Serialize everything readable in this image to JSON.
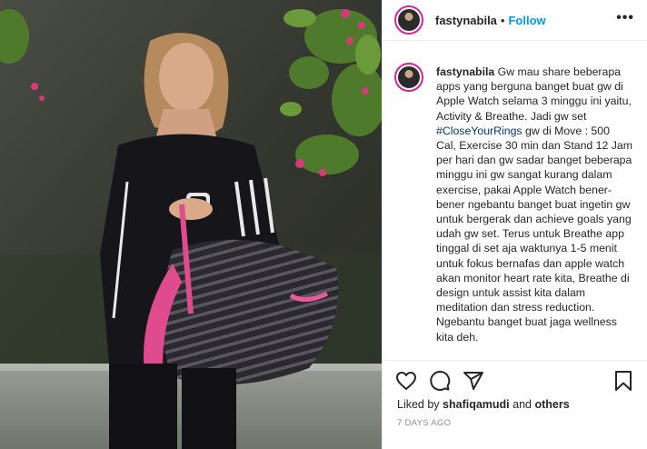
{
  "post": {
    "username": "fastynabila",
    "dot": "•",
    "follow_label": "Follow",
    "more_label": "•••",
    "caption_username": "fastynabila",
    "caption_text_1": "Gw mau share beberapa apps yang berguna banget buat gw di Apple Watch selama 3 minggu ini yaitu, Activity & Breathe. Jadi gw set ",
    "caption_hashtag": "#CloseYourRings",
    "caption_text_2": " gw di Move : 500 Cal, Exercise 30 min dan Stand 12 Jam per hari dan gw sadar banget beberapa minggu ini gw sangat kurang dalam exercise, pakai Apple Watch bener-bener ngebantu banget buat ingetin gw untuk bergerak dan achieve goals yang udah gw set. Terus untuk Breathe app tinggal di set aja waktunya 1-5 menit untuk fokus bernafas dan apple watch akan monitor heart rate kita, Breathe di design untuk assist kita dalam meditation dan stress reduction. Ngebantu banget buat jaga wellness kita deh.",
    "likes_prefix": "Liked by ",
    "likes_user": "shafiqamudi",
    "likes_and": " and ",
    "likes_others": "others",
    "timestamp": "7 DAYS AGO"
  },
  "icons": {
    "like": "heart-icon",
    "comment": "comment-icon",
    "share": "share-icon",
    "save": "bookmark-icon"
  },
  "colors": {
    "follow": "#0095f6",
    "hashtag": "#00376b",
    "timestamp": "#8e8e8e"
  }
}
